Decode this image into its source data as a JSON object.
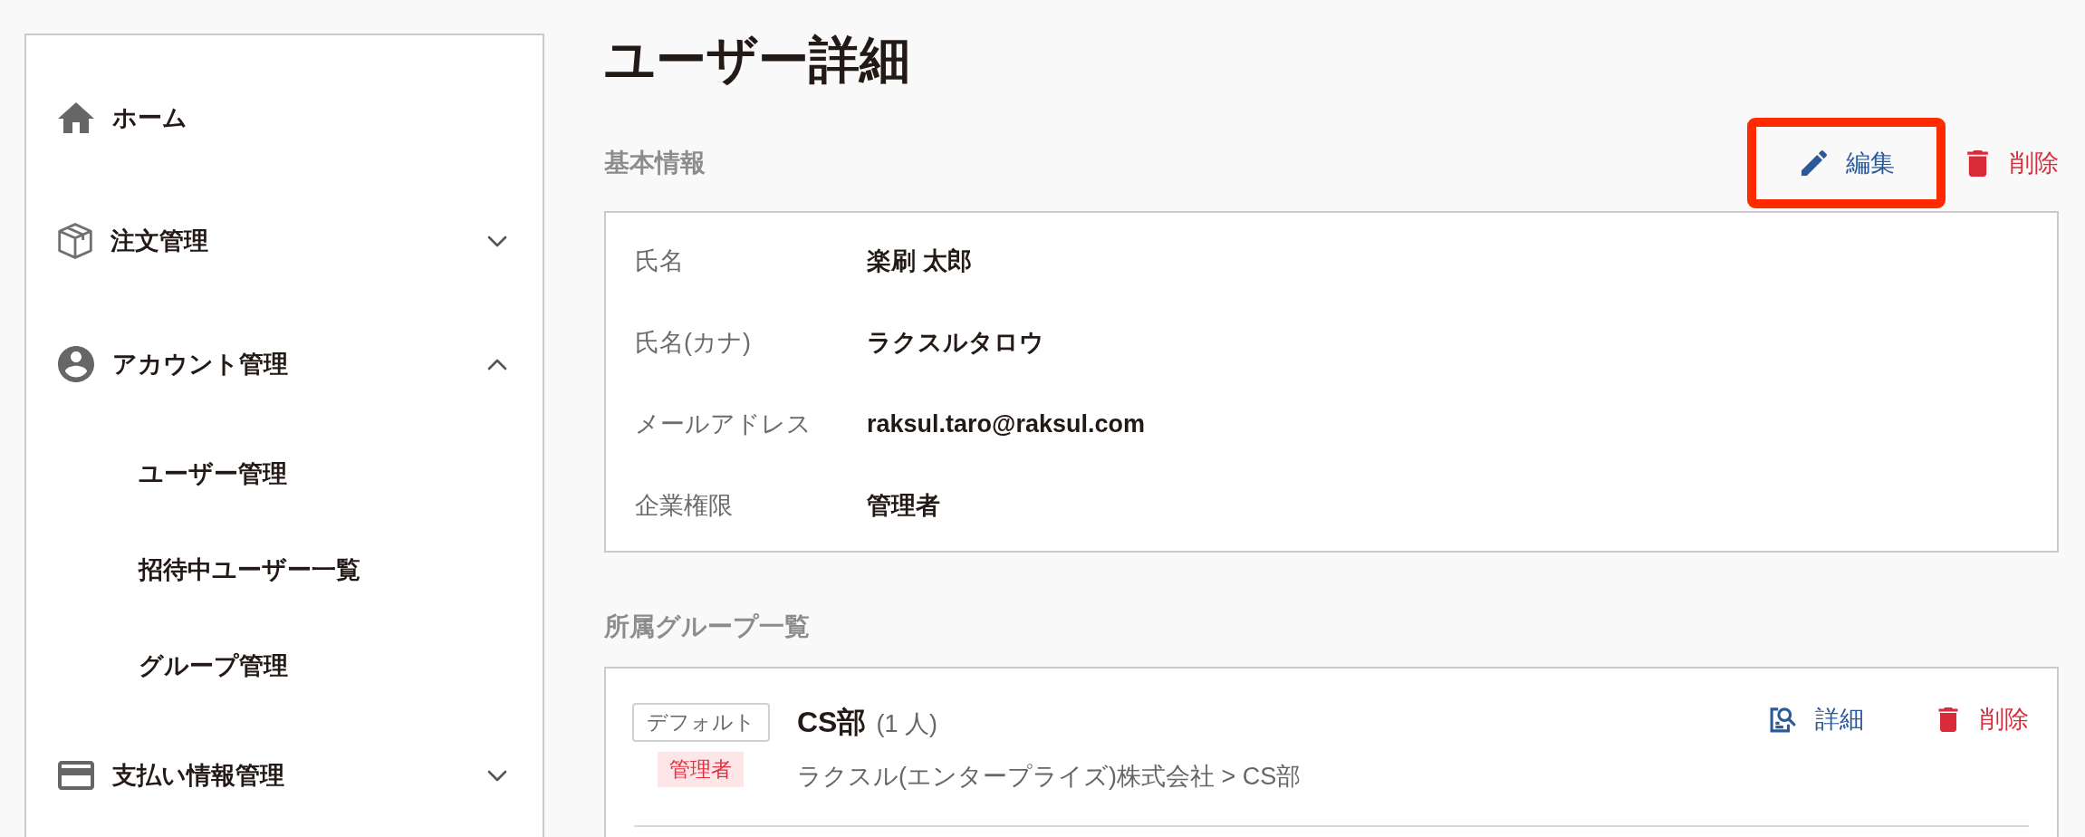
{
  "sidebar": {
    "items": [
      {
        "label": "ホーム",
        "kind": "link"
      },
      {
        "label": "注文管理",
        "kind": "group",
        "expanded": false
      },
      {
        "label": "アカウント管理",
        "kind": "group",
        "expanded": true,
        "children": [
          {
            "label": "ユーザー管理"
          },
          {
            "label": "招待中ユーザー一覧"
          },
          {
            "label": "グループ管理"
          }
        ]
      },
      {
        "label": "支払い情報管理",
        "kind": "group",
        "expanded": false
      }
    ]
  },
  "page": {
    "title": "ユーザー詳細"
  },
  "basic_info": {
    "heading": "基本情報",
    "actions": [
      {
        "label": "編集",
        "kind": "edit",
        "highlighted": true
      },
      {
        "label": "削除",
        "kind": "delete",
        "highlighted": false
      }
    ],
    "fields": [
      {
        "label": "氏名",
        "value": "楽刷 太郎"
      },
      {
        "label": "氏名(カナ)",
        "value": "ラクスルタロウ"
      },
      {
        "label": "メールアドレス",
        "value": "raksul.taro@raksul.com"
      },
      {
        "label": "企業権限",
        "value": "管理者"
      }
    ]
  },
  "groups": {
    "heading": "所属グループ一覧",
    "items": [
      {
        "tags": [
          {
            "label": "デフォルト",
            "kind": "default"
          },
          {
            "label": "管理者",
            "kind": "role"
          }
        ],
        "name": "CS部",
        "member_count": "(1 人)",
        "path": "ラクスル(エンタープライズ)株式会社 > CS部",
        "actions": [
          {
            "label": "詳細",
            "kind": "detail"
          },
          {
            "label": "削除",
            "kind": "delete"
          }
        ]
      }
    ]
  }
}
